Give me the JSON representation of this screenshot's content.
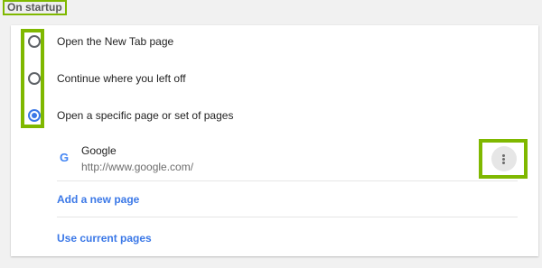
{
  "section": {
    "title": "On startup"
  },
  "startup_options": [
    {
      "label": "Open the New Tab page",
      "selected": false
    },
    {
      "label": "Continue where you left off",
      "selected": false
    },
    {
      "label": "Open a specific page or set of pages",
      "selected": true
    }
  ],
  "pages": [
    {
      "name": "Google",
      "url": "http://www.google.com/",
      "favicon": "google-favicon"
    }
  ],
  "actions": {
    "add_page": "Add a new page",
    "use_current": "Use current pages"
  },
  "colors": {
    "accent": "#3b78e7",
    "highlight": "#7fb800"
  }
}
